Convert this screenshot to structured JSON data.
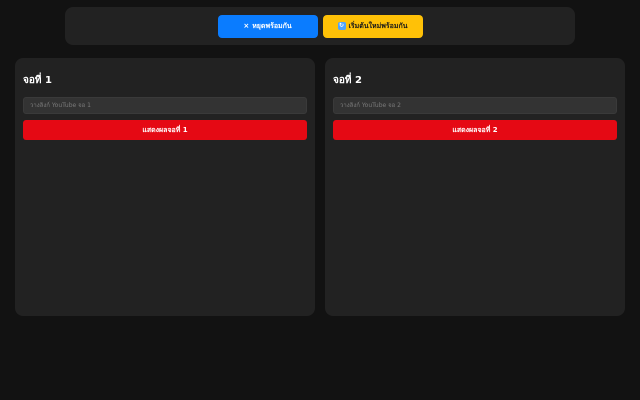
{
  "controls": {
    "pause_icon": "×",
    "pause_label": "หยุดพร้อมกัน",
    "restart_icon": "↻",
    "restart_label": "เริ่มต้นใหม่พร้อมกัน"
  },
  "screens": [
    {
      "title": "จอที่ 1",
      "input_placeholder": "วางลิงก์ YouTube จอ 1",
      "input_value": "",
      "button_label": "แสดงผลจอที่ 1"
    },
    {
      "title": "จอที่ 2",
      "input_placeholder": "วางลิงก์ YouTube จอ 2",
      "input_value": "",
      "button_label": "แสดงผลจอที่ 2"
    }
  ],
  "colors": {
    "background": "#121212",
    "panel": "#222222",
    "pause_button": "#0a7cff",
    "restart_button": "#ffc107",
    "show_button": "#e50914"
  },
  "icons": {
    "pause": "close-icon",
    "restart": "refresh-icon"
  }
}
